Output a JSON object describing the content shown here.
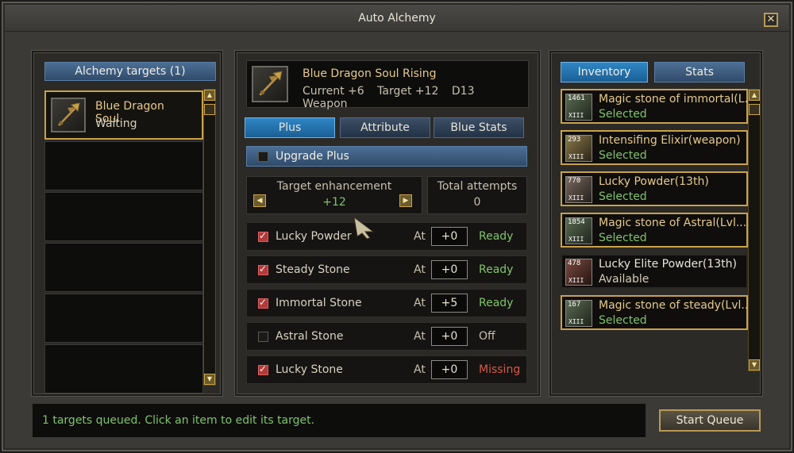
{
  "window": {
    "title": "Auto Alchemy",
    "close_label": "✕"
  },
  "left": {
    "header": "Alchemy targets (1)",
    "targets": [
      {
        "name": "Blue Dragon Soul...",
        "status": "Waiting"
      }
    ]
  },
  "item": {
    "title": "Blue Dragon Soul Rising",
    "current": "Current +6",
    "target": "Target +12",
    "grade": "D13 Weapon"
  },
  "tabs": [
    "Plus",
    "Attribute",
    "Blue Stats"
  ],
  "upgrade_plus": {
    "label": "Upgrade Plus",
    "checked": false
  },
  "enhancement": {
    "label": "Target enhancement",
    "value": "+12",
    "left_arrow": "◀",
    "right_arrow": "▶"
  },
  "attempts": {
    "label": "Total attempts",
    "value": "0"
  },
  "materials": [
    {
      "name": "Lucky Powder",
      "checked": true,
      "at": "At",
      "level": "+0",
      "status": "Ready",
      "status_color": "#7fc46a"
    },
    {
      "name": "Steady Stone",
      "checked": true,
      "at": "At",
      "level": "+0",
      "status": "Ready",
      "status_color": "#7fc46a"
    },
    {
      "name": "Immortal Stone",
      "checked": true,
      "at": "At",
      "level": "+5",
      "status": "Ready",
      "status_color": "#7fc46a"
    },
    {
      "name": "Astral Stone",
      "checked": false,
      "at": "At",
      "level": "+0",
      "status": "Off",
      "status_color": "#c7c0ae"
    },
    {
      "name": "Lucky Stone",
      "checked": true,
      "at": "At",
      "level": "+0",
      "status": "Missing",
      "status_color": "#d65a4a"
    }
  ],
  "right_tabs": [
    "Inventory",
    "Stats"
  ],
  "inventory": [
    {
      "count": "1461",
      "grade": "XIII",
      "name": "Magic stone of immortal(L...",
      "status": "Selected",
      "selected": true
    },
    {
      "count": "293",
      "grade": "XIII",
      "name": "Intensifing Elixir(weapon)",
      "status": "Selected",
      "selected": true
    },
    {
      "count": "770",
      "grade": "XIII",
      "name": "Lucky Powder(13th)",
      "status": "Selected",
      "selected": true
    },
    {
      "count": "1854",
      "grade": "XIII",
      "name": "Magic stone of Astral(Lvl....",
      "status": "Selected",
      "selected": true
    },
    {
      "count": "478",
      "grade": "XIII",
      "name": "Lucky Elite Powder(13th)",
      "status": "Available",
      "selected": false
    },
    {
      "count": "167",
      "grade": "XIII",
      "name": "Magic stone of steady(Lvl...",
      "status": "Selected",
      "selected": true
    }
  ],
  "status_message": "1 targets queued. Click an item to edit its target.",
  "start_button": "Start Queue",
  "colors": {
    "accent_gold": "#c9a24a",
    "tab_active": "#2f86c4",
    "ready_green": "#7fc46a",
    "missing_red": "#d65a4a"
  }
}
